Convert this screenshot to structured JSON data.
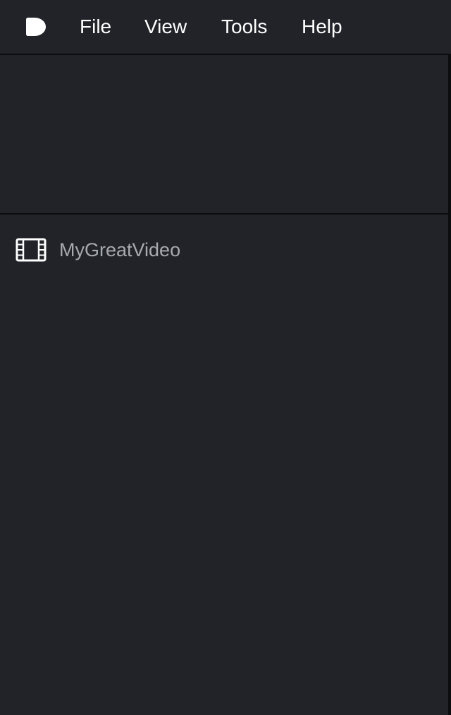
{
  "menubar": {
    "logo_icon": "app-logo-icon",
    "items": [
      {
        "label": "File"
      },
      {
        "label": "View"
      },
      {
        "label": "Tools"
      },
      {
        "label": "Help"
      }
    ]
  },
  "project": {
    "items": [
      {
        "icon": "film-icon",
        "label": "MyGreatVideo"
      }
    ]
  },
  "colors": {
    "background": "#212328",
    "divider": "#0c0d0f",
    "menu_text": "#ffffff",
    "item_text": "#a7aaaf"
  }
}
